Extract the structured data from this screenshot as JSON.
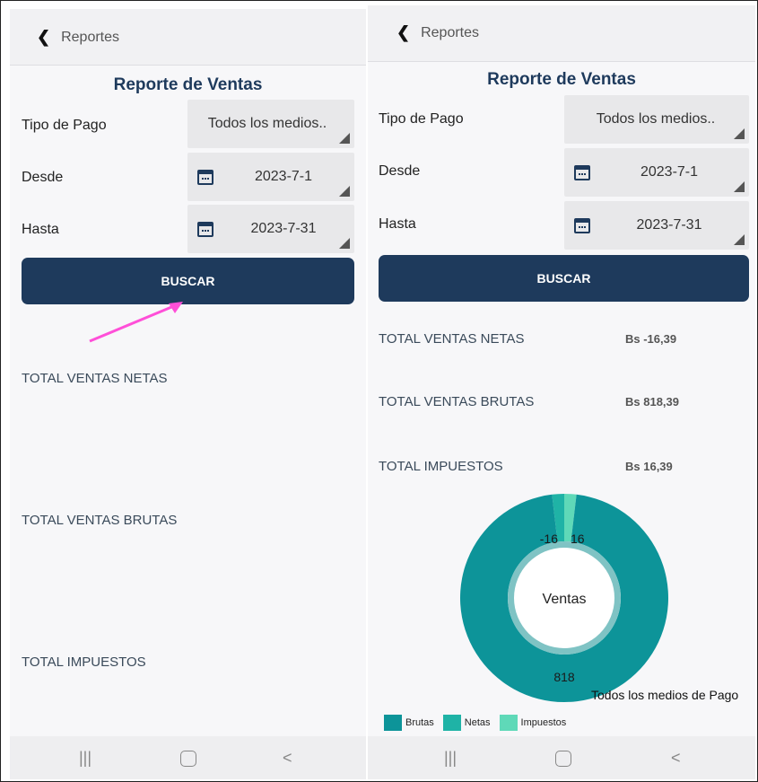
{
  "left_screen": {
    "back_label": "Reportes",
    "title": "Reporte de Ventas",
    "tipo_pago_label": "Tipo de Pago",
    "tipo_pago_value": "Todos los medios..",
    "desde_label": "Desde",
    "desde_value": "2023-7-1",
    "hasta_label": "Hasta",
    "hasta_value": "2023-7-31",
    "buscar_label": "BUSCAR",
    "total_netas_label": "TOTAL VENTAS NETAS",
    "total_brutas_label": "TOTAL VENTAS BRUTAS",
    "total_impuestos_label": "TOTAL IMPUESTOS",
    "annotation_arrow_color": "#ff4fd8"
  },
  "right_screen": {
    "back_label": "Reportes",
    "title": "Reporte de Ventas",
    "tipo_pago_label": "Tipo de Pago",
    "tipo_pago_value": "Todos los medios..",
    "desde_label": "Desde",
    "desde_value": "2023-7-1",
    "hasta_label": "Hasta",
    "hasta_value": "2023-7-31",
    "buscar_label": "BUSCAR",
    "total_netas_label": "TOTAL VENTAS NETAS",
    "total_netas_value": "Bs -16,39",
    "total_brutas_label": "TOTAL VENTAS BRUTAS",
    "total_brutas_value": "Bs 818,39",
    "total_impuestos_label": "TOTAL IMPUESTOS",
    "total_impuestos_value": "Bs 16,39"
  },
  "chart_data": {
    "type": "pie",
    "title": "Ventas",
    "caption": "Todos los medios de Pago",
    "categories": [
      "Brutas",
      "Netas",
      "Impuestos"
    ],
    "values": [
      818,
      -16,
      16
    ],
    "value_labels": [
      "818",
      "-16",
      "16"
    ],
    "legend_position": "bottom",
    "colors": [
      "#0d9499",
      "#1fb3a6",
      "#5fd9b8"
    ]
  },
  "colors": {
    "primary": "#1e3a5c",
    "background": "#f7f7f9",
    "field_bg": "#e8e8ea",
    "annotation": "#ff4fd8"
  },
  "icons": {
    "back": "chevron-left-icon",
    "calendar": "calendar-icon",
    "dropdown": "dropdown-corner-icon",
    "nav_recent": "recent-apps-icon",
    "nav_home": "home-icon",
    "nav_back": "back-icon"
  },
  "navbar": {
    "recent_glyph": "|||",
    "back_glyph": "<"
  }
}
